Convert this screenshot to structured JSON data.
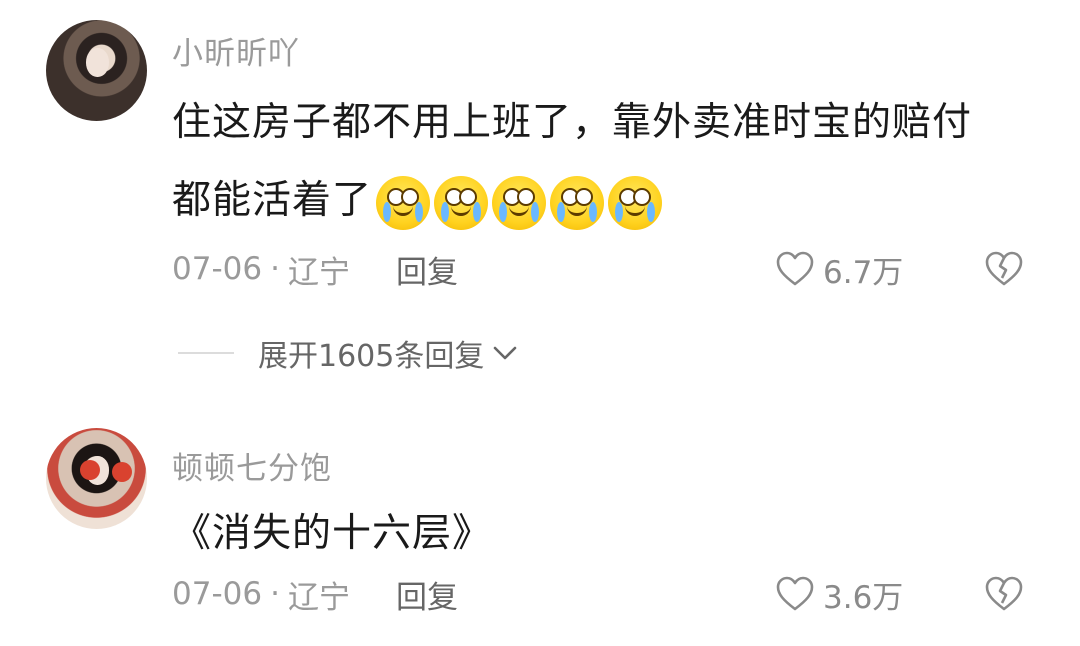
{
  "comments": [
    {
      "username": "小昕昕吖",
      "text_line1": "住这房子都不用上班了，靠外卖准时宝的赔付",
      "text_line2": "都能活着了",
      "emoji_icon": "crying-laughing-emoji",
      "emoji_count": 5,
      "date": "07-06",
      "location": "辽宁",
      "reply_label": "回复",
      "likes": "6.7万",
      "expand_label": "展开1605条回复"
    },
    {
      "username": "顿顿七分饱",
      "text_line1": "《消失的十六层》",
      "date": "07-06",
      "location": "辽宁",
      "reply_label": "回复",
      "likes": "3.6万"
    }
  ],
  "separator": "·"
}
